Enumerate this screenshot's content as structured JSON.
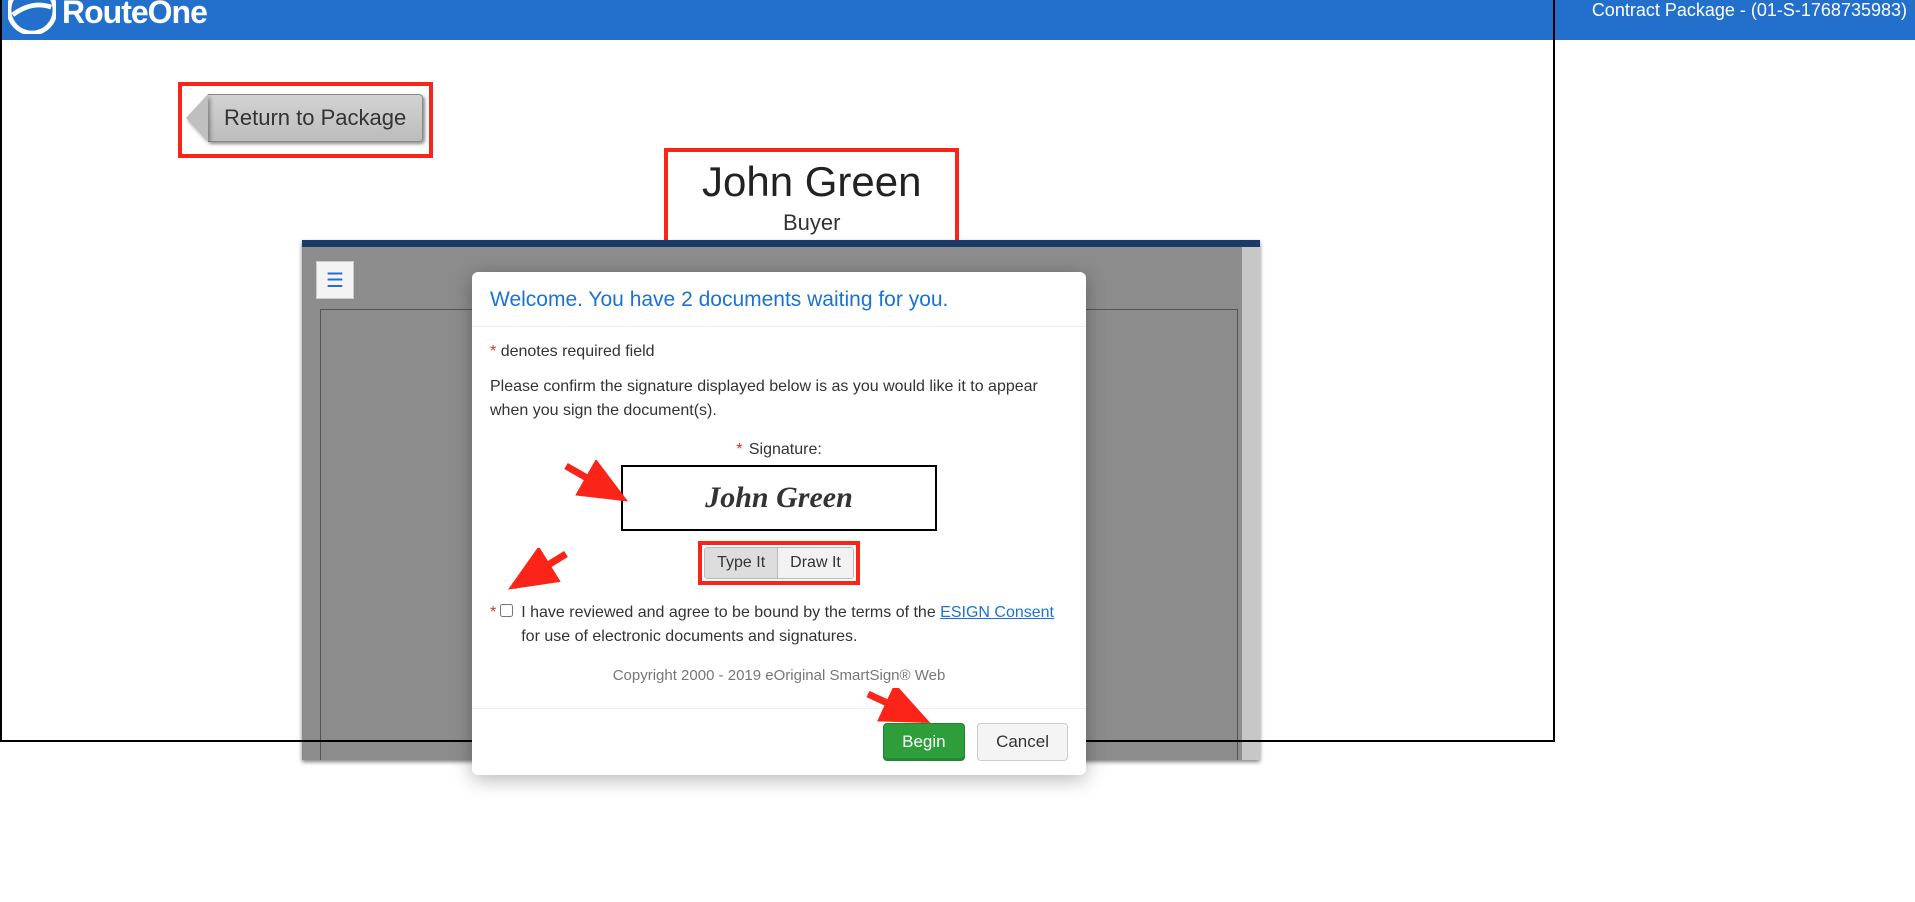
{
  "header": {
    "brand": "RouteOne",
    "package_label": "Contract Package - (01-S-1768735983)"
  },
  "return_btn_label": "Return to Package",
  "signer": {
    "name": "John Green",
    "role": "Buyer"
  },
  "modal": {
    "welcome": "Welcome. You have 2 documents waiting for you.",
    "required_note": "denotes required field",
    "confirm_text": "Please confirm the signature displayed below is as you would like it to appear when you sign the document(s).",
    "signature_label": "Signature:",
    "signature_value": "John Green",
    "type_it_label": "Type It",
    "draw_it_label": "Draw It",
    "consent_pre": "I have reviewed and agree to be bound by the terms of the ",
    "consent_link": "ESIGN Consent",
    "consent_post": " for use of electronic documents and signatures.",
    "copyright": "Copyright 2000 - 2019 eOriginal SmartSign® Web",
    "begin_label": "Begin",
    "cancel_label": "Cancel"
  }
}
